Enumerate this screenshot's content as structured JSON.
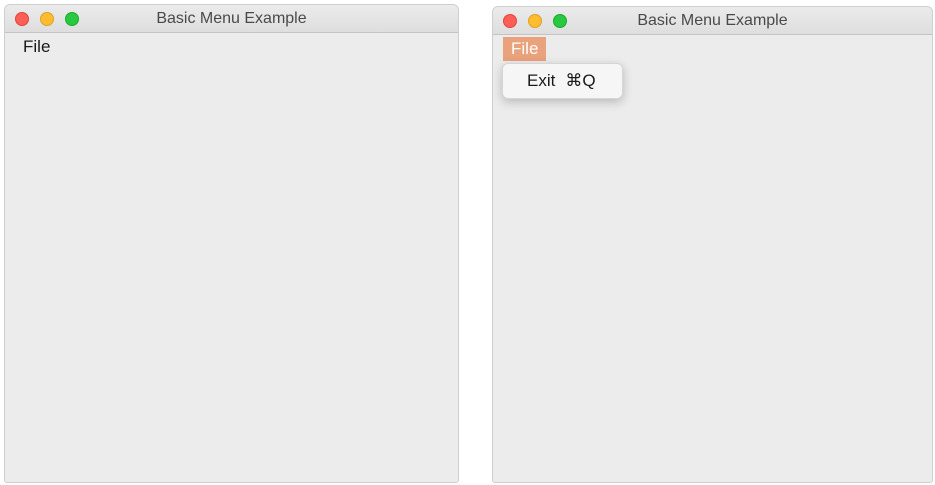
{
  "colors": {
    "close": "#fd5f57",
    "minimize": "#febc2e",
    "maximize": "#28c840",
    "menu_highlight": "#e9a27c",
    "window_bg": "#ececec"
  },
  "left_window": {
    "title": "Basic Menu Example",
    "menubar": {
      "file_label": "File"
    }
  },
  "right_window": {
    "title": "Basic Menu Example",
    "menubar": {
      "file_label": "File",
      "file_state": "open"
    },
    "file_menu": {
      "items": [
        {
          "label": "Exit",
          "shortcut": "⌘Q"
        }
      ]
    }
  }
}
